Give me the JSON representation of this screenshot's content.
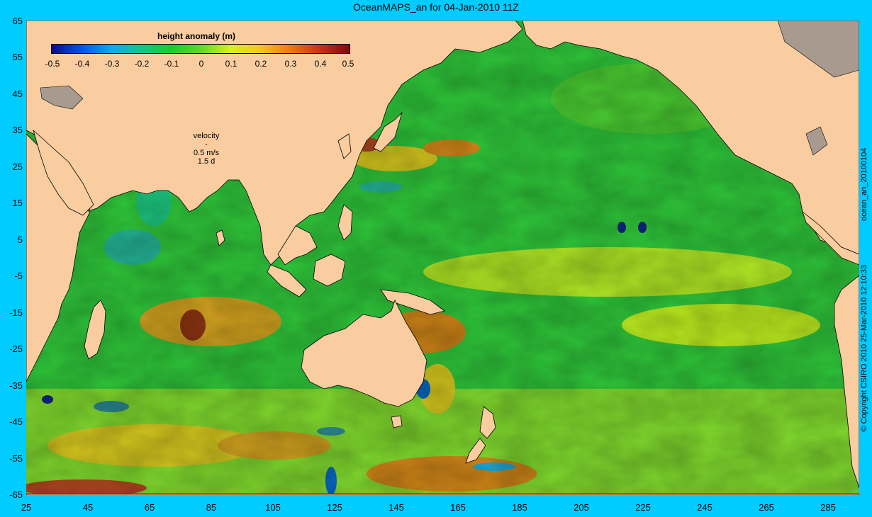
{
  "title": "OceanMAPS_an for 04-Jan-2010 11Z",
  "map": {
    "type": "sea surface height anomaly map",
    "lon_range": [
      25,
      295
    ],
    "lat_range": [
      -65,
      65
    ],
    "y_ticks": [
      "65",
      "55",
      "45",
      "35",
      "25",
      "15",
      "5",
      "-5",
      "-15",
      "-25",
      "-35",
      "-45",
      "-55",
      "-65"
    ],
    "x_ticks": [
      "25",
      "45",
      "65",
      "85",
      "105",
      "125",
      "145",
      "165",
      "185",
      "205",
      "225",
      "245",
      "265",
      "285"
    ],
    "land_color": "#f9cda0",
    "frame_color": "#00ccff"
  },
  "colorbar": {
    "title": "height anomaly (m)",
    "ticks": [
      "-0.5",
      "-0.4",
      "-0.3",
      "-0.2",
      "-0.1",
      "0",
      "0.1",
      "0.2",
      "0.3",
      "0.4",
      "0.5"
    ],
    "range": [
      -0.5,
      0.5
    ],
    "colors": [
      "#0a0a8a",
      "#0057d8",
      "#1aa3f0",
      "#19c48a",
      "#1fc82c",
      "#5fd82a",
      "#d6f21a",
      "#f4c81a",
      "#ec7a12",
      "#c8321a",
      "#7a0a0a"
    ]
  },
  "velocity_key": {
    "label": "velocity",
    "arrow": "-",
    "speed": "0.5 m/s",
    "duration": "1.5 d"
  },
  "side_text": {
    "copyright": "© Copyright CSIRO 2010    25-Mar-2010 12:10:33",
    "file_id": "ocean_an_20100104"
  }
}
